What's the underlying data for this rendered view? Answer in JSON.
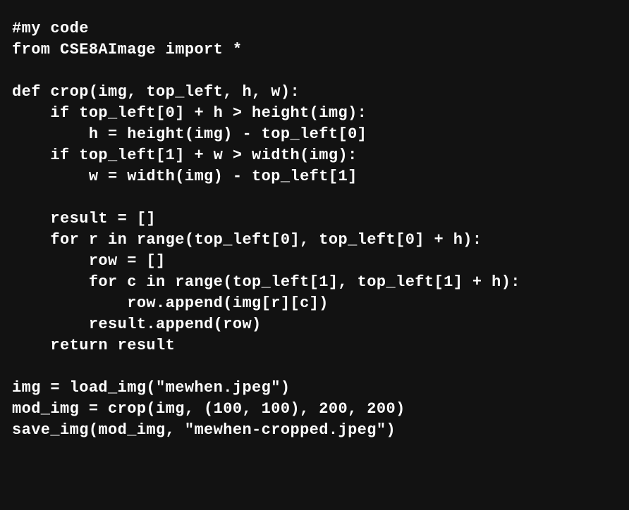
{
  "editor": {
    "background": "#121212",
    "text_color": "#ffffff",
    "lines": [
      "#my code",
      "from CSE8AImage import *",
      "",
      "def crop(img, top_left, h, w):",
      "    if top_left[0] + h > height(img):",
      "        h = height(img) - top_left[0]",
      "    if top_left[1] + w > width(img):",
      "        w = width(img) - top_left[1]",
      "",
      "    result = []",
      "    for r in range(top_left[0], top_left[0] + h):",
      "        row = []",
      "        for c in range(top_left[1], top_left[1] + h):",
      "            row.append(img[r][c])",
      "        result.append(row)",
      "    return result",
      "",
      "img = load_img(\"mewhen.jpeg\")",
      "mod_img = crop(img, (100, 100), 200, 200)",
      "save_img(mod_img, \"mewhen-cropped.jpeg\")"
    ]
  }
}
